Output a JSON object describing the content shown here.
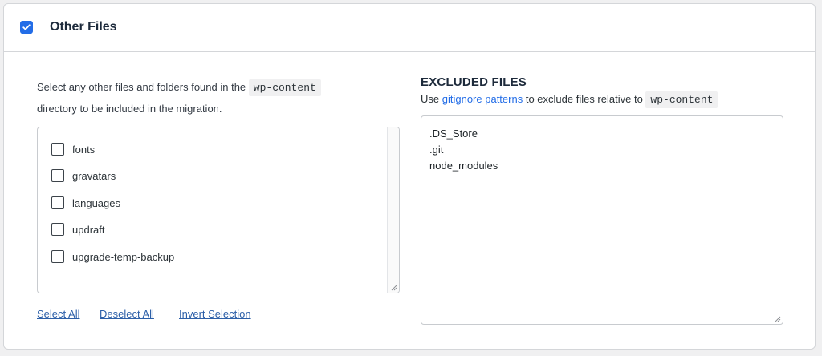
{
  "section": {
    "title": "Other Files",
    "enabled": true
  },
  "left": {
    "intro_prefix": "Select any other files and folders found in the",
    "intro_code": "wp-content",
    "intro_suffix": "directory to be included in the migration.",
    "files": [
      {
        "label": "fonts",
        "checked": false
      },
      {
        "label": "gravatars",
        "checked": false
      },
      {
        "label": "languages",
        "checked": false
      },
      {
        "label": "updraft",
        "checked": false
      },
      {
        "label": "upgrade-temp-backup",
        "checked": false
      }
    ],
    "actions": {
      "select_all": "Select All",
      "deselect_all": "Deselect All",
      "invert_selection": "Invert Selection"
    }
  },
  "excluded": {
    "title": "EXCLUDED FILES",
    "use_text": "Use",
    "link_text": "gitignore patterns",
    "middle_text": "to exclude files relative to",
    "code": "wp-content",
    "value": ".DS_Store\n.git\nnode_modules"
  },
  "colors": {
    "accent": "#236de7",
    "link": "#2c5fa8",
    "heading": "#1d2a3b"
  }
}
